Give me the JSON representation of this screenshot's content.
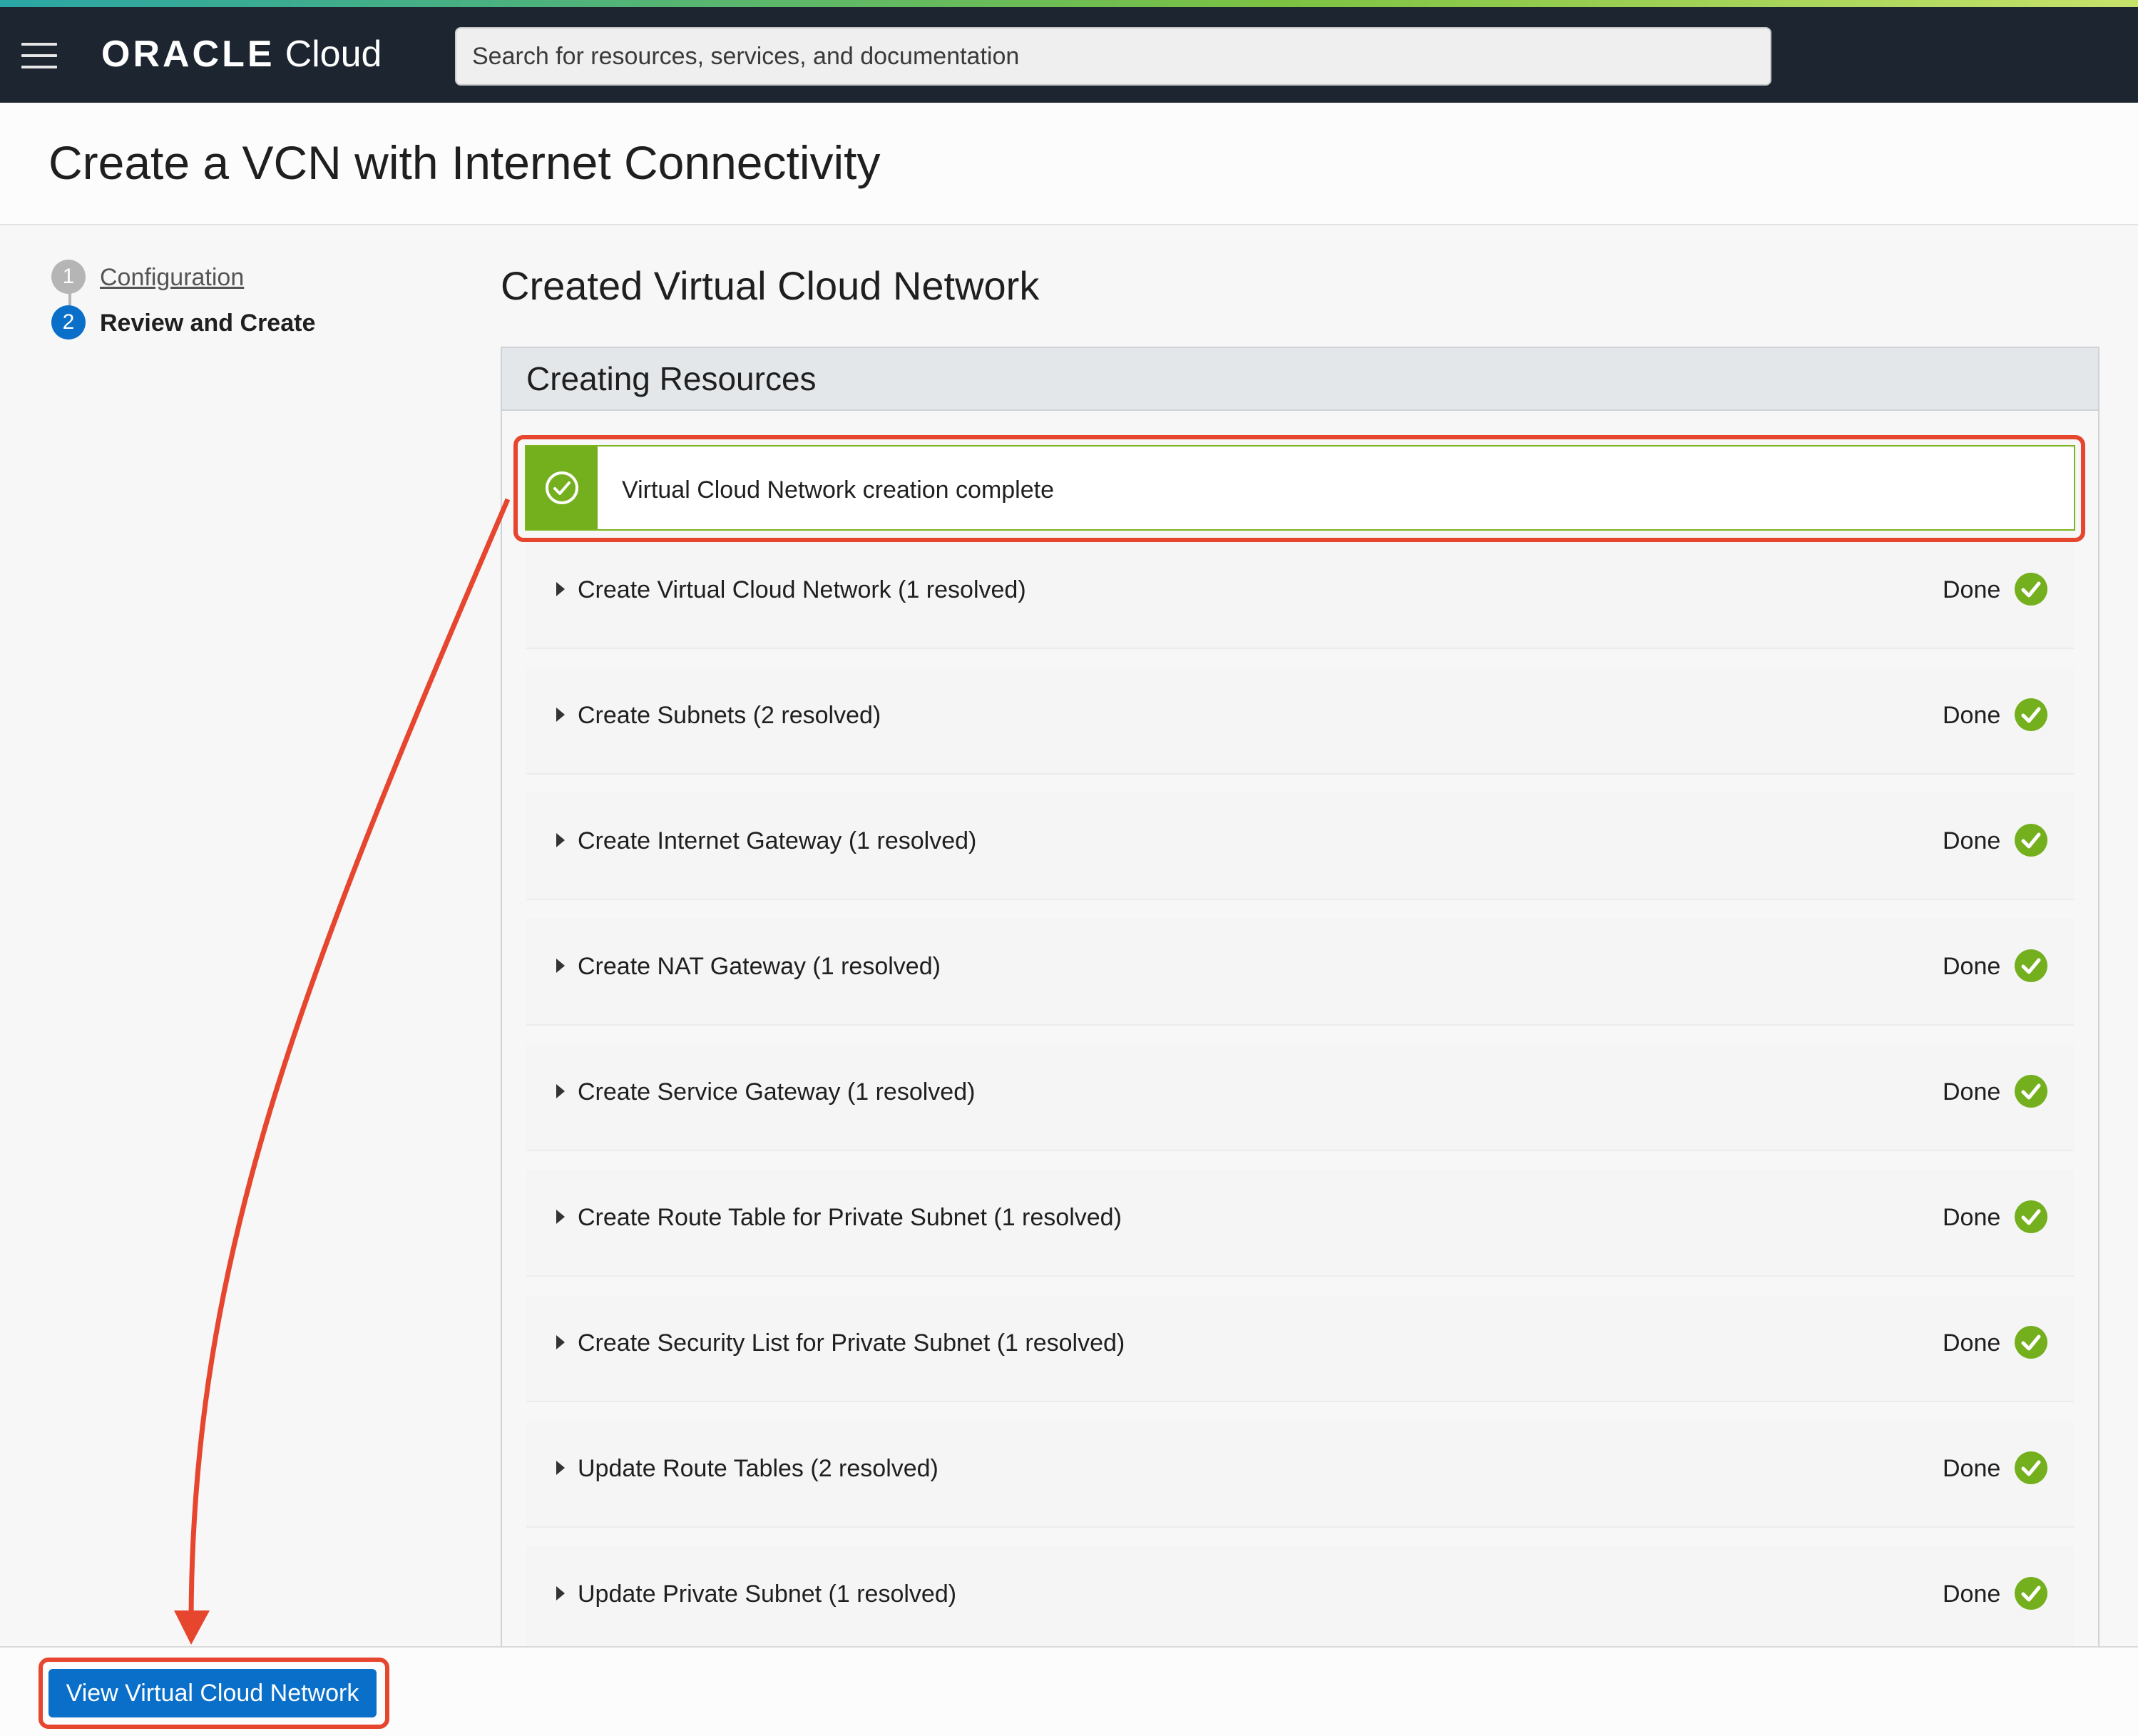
{
  "header": {
    "brand_oracle": "ORACLE",
    "brand_cloud": "Cloud",
    "search_placeholder": "Search for resources, services, and documentation"
  },
  "page": {
    "title": "Create a VCN with Internet Connectivity"
  },
  "steps": [
    {
      "number": "1",
      "label": "Configuration",
      "state": "completed"
    },
    {
      "number": "2",
      "label": "Review and Create",
      "state": "current"
    }
  ],
  "main": {
    "section_title": "Created Virtual Cloud Network",
    "panel_title": "Creating Resources",
    "banner": "Virtual Cloud Network creation complete",
    "resources": [
      {
        "label": "Create Virtual Cloud Network (1 resolved)",
        "status": "Done"
      },
      {
        "label": "Create Subnets (2 resolved)",
        "status": "Done"
      },
      {
        "label": "Create Internet Gateway (1 resolved)",
        "status": "Done"
      },
      {
        "label": "Create NAT Gateway (1 resolved)",
        "status": "Done"
      },
      {
        "label": "Create Service Gateway (1 resolved)",
        "status": "Done"
      },
      {
        "label": "Create Route Table for Private Subnet (1 resolved)",
        "status": "Done"
      },
      {
        "label": "Create Security List for Private Subnet (1 resolved)",
        "status": "Done"
      },
      {
        "label": "Update Route Tables (2 resolved)",
        "status": "Done"
      },
      {
        "label": "Update Private Subnet (1 resolved)",
        "status": "Done"
      }
    ]
  },
  "footer": {
    "primary_button": "View Virtual Cloud Network"
  },
  "colors": {
    "topbar": "#1c2530",
    "primary": "#0a6fc9",
    "success": "#74af1e",
    "annotation": "#e6452e"
  },
  "icons": {
    "menu": "hamburger-icon",
    "banner": "check-circle-icon",
    "status": "check-circle-icon",
    "expand": "caret-right-icon"
  }
}
